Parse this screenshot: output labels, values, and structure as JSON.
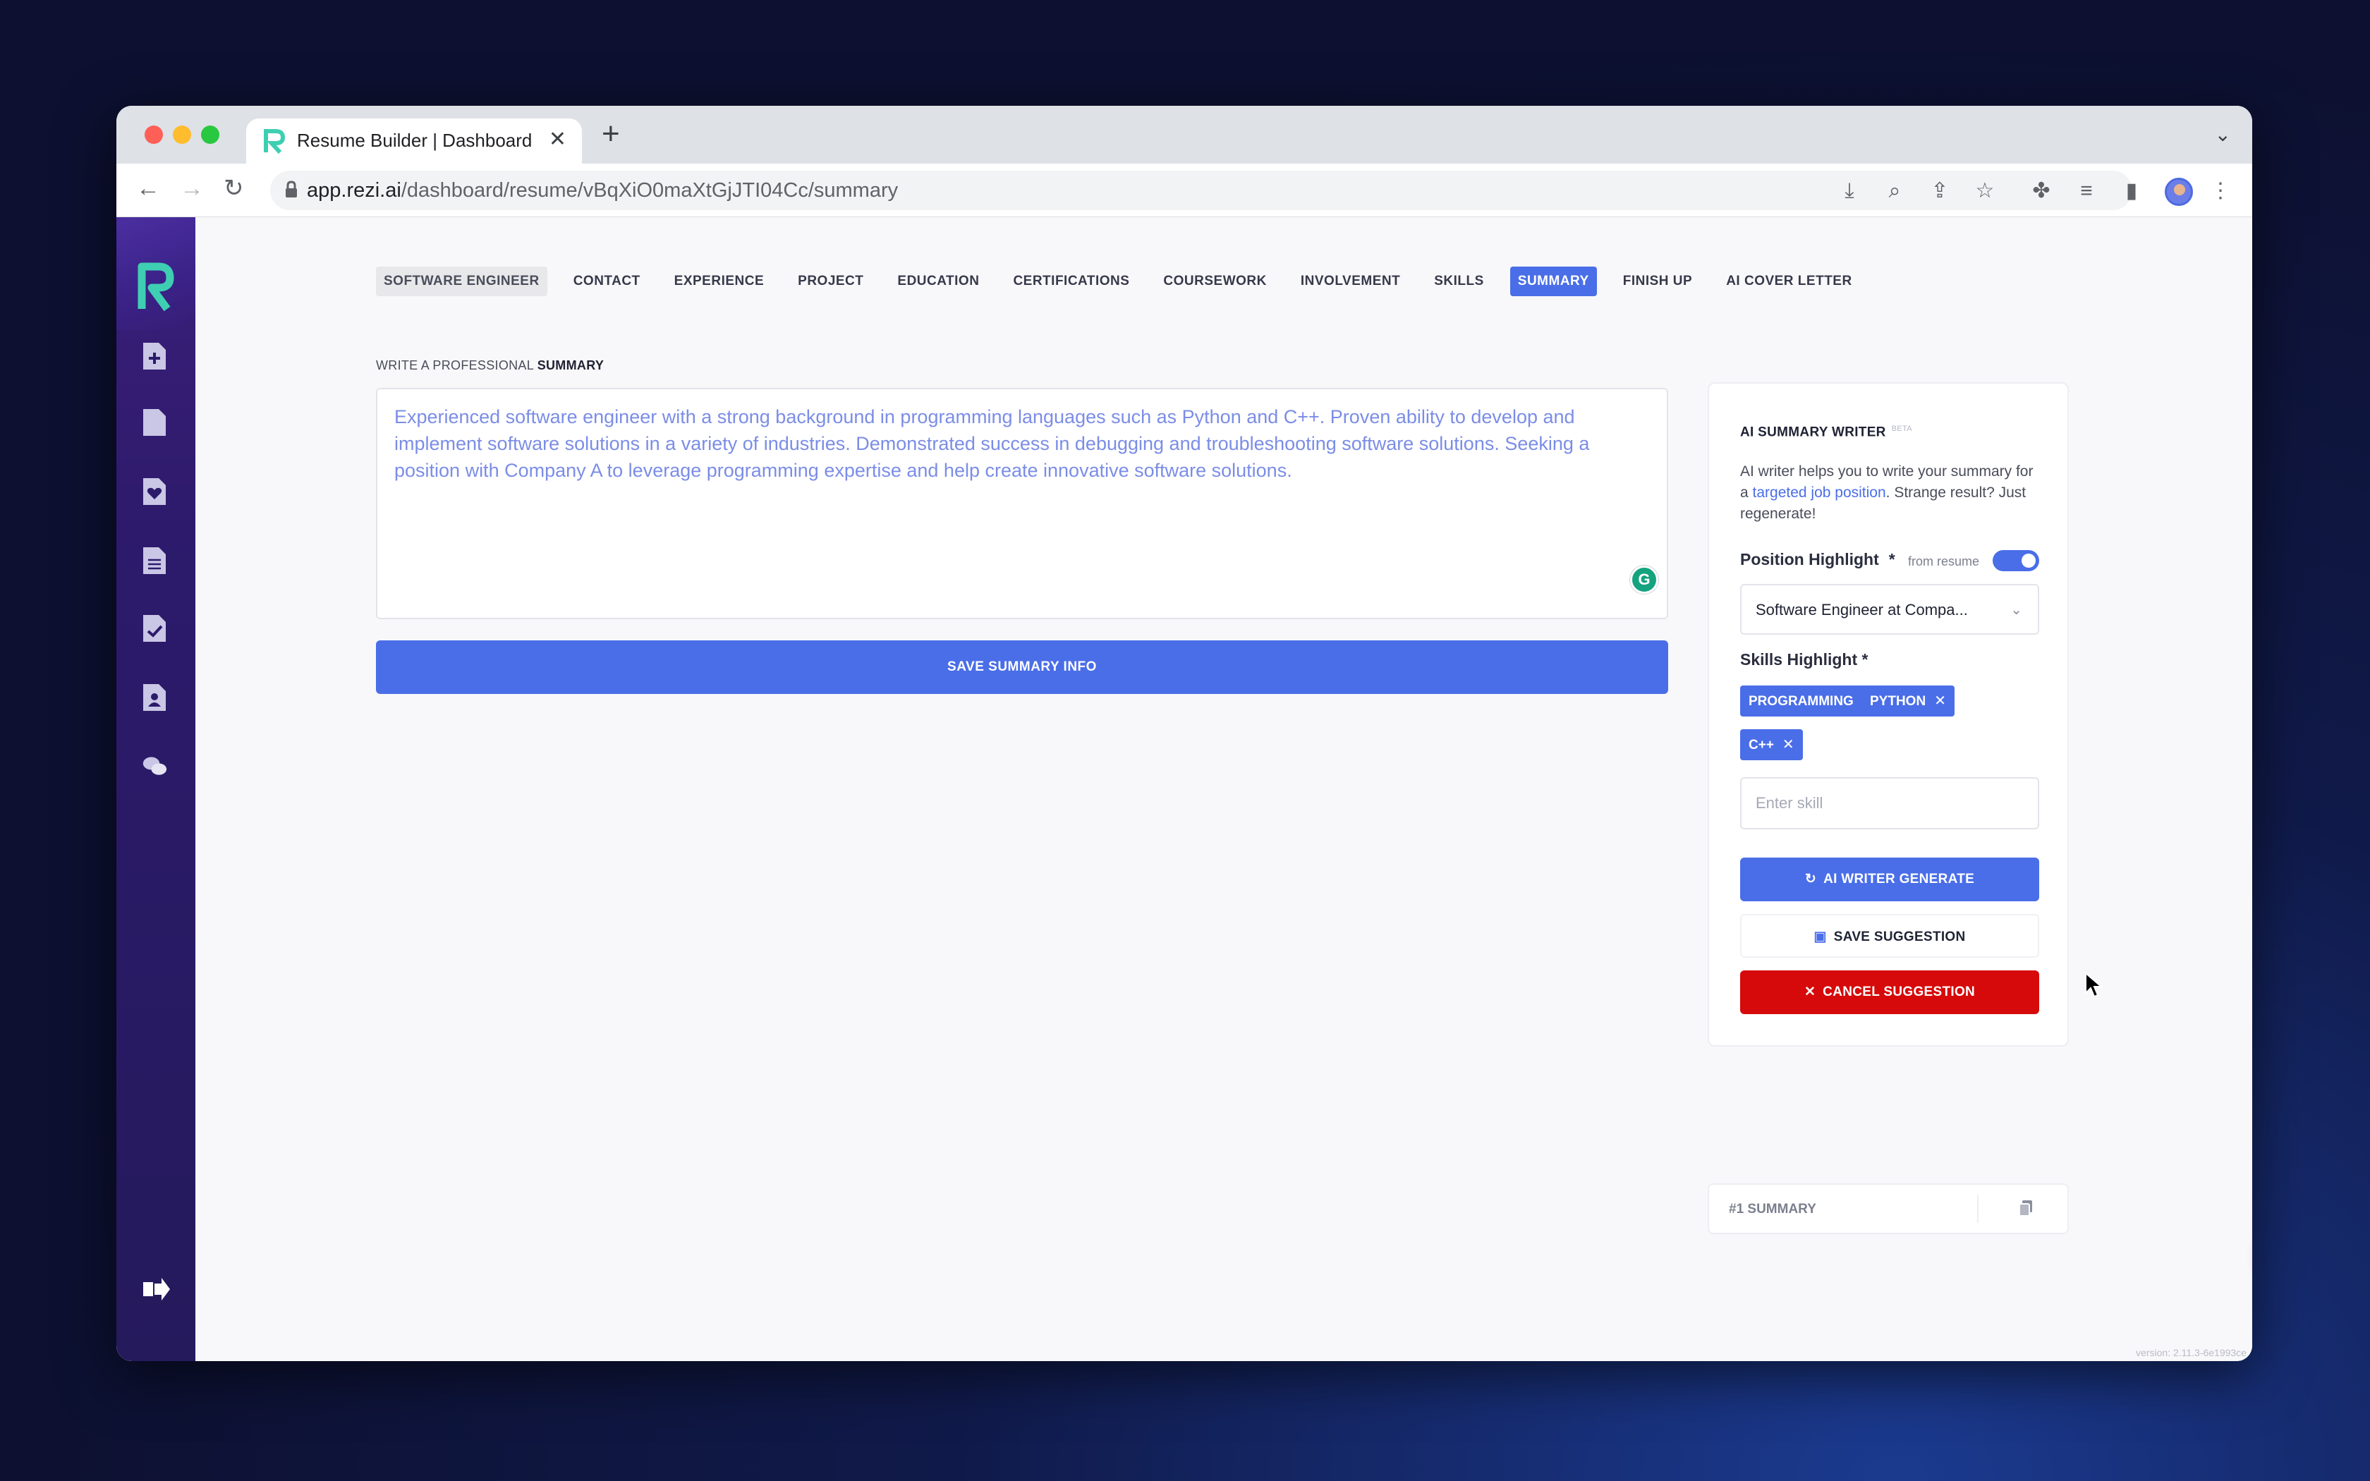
{
  "browser": {
    "tab_title": "Resume Builder | Dashboard",
    "url_domain": "app.rezi.ai",
    "url_path": "/dashboard/resume/vBqXiO0maXtGjJTI04Cc/summary"
  },
  "steps": [
    {
      "label": "SOFTWARE ENGINEER",
      "state": "done"
    },
    {
      "label": "CONTACT",
      "state": "normal"
    },
    {
      "label": "EXPERIENCE",
      "state": "normal"
    },
    {
      "label": "PROJECT",
      "state": "normal"
    },
    {
      "label": "EDUCATION",
      "state": "normal"
    },
    {
      "label": "CERTIFICATIONS",
      "state": "normal"
    },
    {
      "label": "COURSEWORK",
      "state": "normal"
    },
    {
      "label": "INVOLVEMENT",
      "state": "normal"
    },
    {
      "label": "SKILLS",
      "state": "normal"
    },
    {
      "label": "SUMMARY",
      "state": "active"
    },
    {
      "label": "FINISH UP",
      "state": "normal"
    },
    {
      "label": "AI COVER LETTER",
      "state": "normal"
    }
  ],
  "editor": {
    "section_prefix": "WRITE A PROFESSIONAL",
    "section_name": "SUMMARY",
    "summary_text": "Experienced software engineer with a strong background in programming languages such as Python and C++. Proven ability to develop and implement software solutions in a variety of industries. Demonstrated success in debugging and troubleshooting software solutions. Seeking a position with Company A to leverage programming expertise and help create innovative software solutions.",
    "save_button": "SAVE SUMMARY INFO"
  },
  "ai_writer": {
    "title": "AI SUMMARY WRITER",
    "badge": "BETA",
    "desc_start": "AI writer helps you to write your summary for a ",
    "desc_link": "targeted job position",
    "desc_end": ". Strange result? Just regenerate!",
    "position_label": "Position Highlight",
    "required_mark": "*",
    "from_resume_label": "from resume",
    "from_resume_on": true,
    "position_value": "Software Engineer at Compa...",
    "skills_label": "Skills Highlight *",
    "skills": [
      "PROGRAMMING",
      "PYTHON",
      "C++"
    ],
    "skill_placeholder": "Enter skill",
    "generate_button": "AI WRITER GENERATE",
    "save_button": "SAVE SUGGESTION",
    "cancel_button": "CANCEL SUGGESTION"
  },
  "summary_list": {
    "item_label": "#1 SUMMARY"
  },
  "version": "version: 2.11.3-6e1993ce",
  "colors": {
    "accent": "#4a6ee8",
    "danger": "#d60a0a",
    "sidebar": "#2c1a6b",
    "logo": "#3ecfb2"
  },
  "icons": {
    "sidebar": [
      "add-document-icon",
      "document-icon",
      "heart-document-icon",
      "lines-document-icon",
      "check-document-icon",
      "person-document-icon",
      "chat-bubbles-icon",
      "logout-icon"
    ]
  }
}
